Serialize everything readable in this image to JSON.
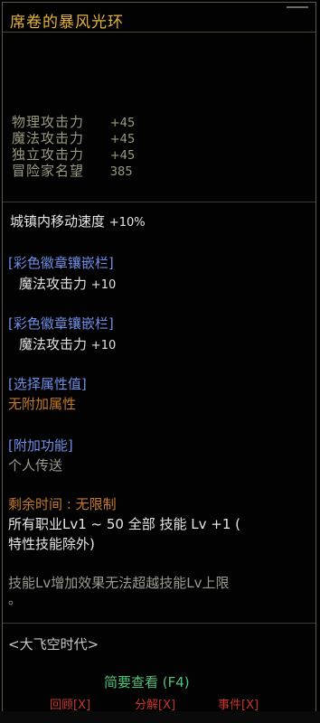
{
  "item": {
    "title": "席卷的暴风光环",
    "stats": [
      {
        "name": "物理攻击力",
        "value": "+45"
      },
      {
        "name": "魔法攻击力",
        "value": "+45"
      },
      {
        "name": "独立攻击力",
        "value": "+45"
      },
      {
        "name": "冒险家名望",
        "value": "385"
      }
    ],
    "town_speed": {
      "label": "城镇内移动速度",
      "value": "+10%"
    },
    "slot1": {
      "header": "[彩色徽章镶嵌栏]",
      "stat": "魔法攻击力",
      "value": "+10"
    },
    "slot2": {
      "header": "[彩色徽章镶嵌栏]",
      "stat": "魔法攻击力",
      "value": "+10"
    },
    "select_attr": {
      "header": "[选择属性值]",
      "text": "无附加属性"
    },
    "extra_func": {
      "header": "[附加功能]",
      "text": "个人传送"
    },
    "remain_time": "剩余时间 : 无限制",
    "skill_line1": "所有职业Lv1 ~ 50 全部 技能 Lv +1 (",
    "skill_line2": "特性技能除外)",
    "limit_line1": "技能Lv增加效果无法超越技能Lv上限",
    "limit_line2": "。",
    "series": "<大飞空时代>",
    "summary": "简要查看 (F4)",
    "buttons": {
      "recycle": "回顾[X]",
      "decompose": "分解[X]",
      "trade": "事件[X]"
    }
  }
}
